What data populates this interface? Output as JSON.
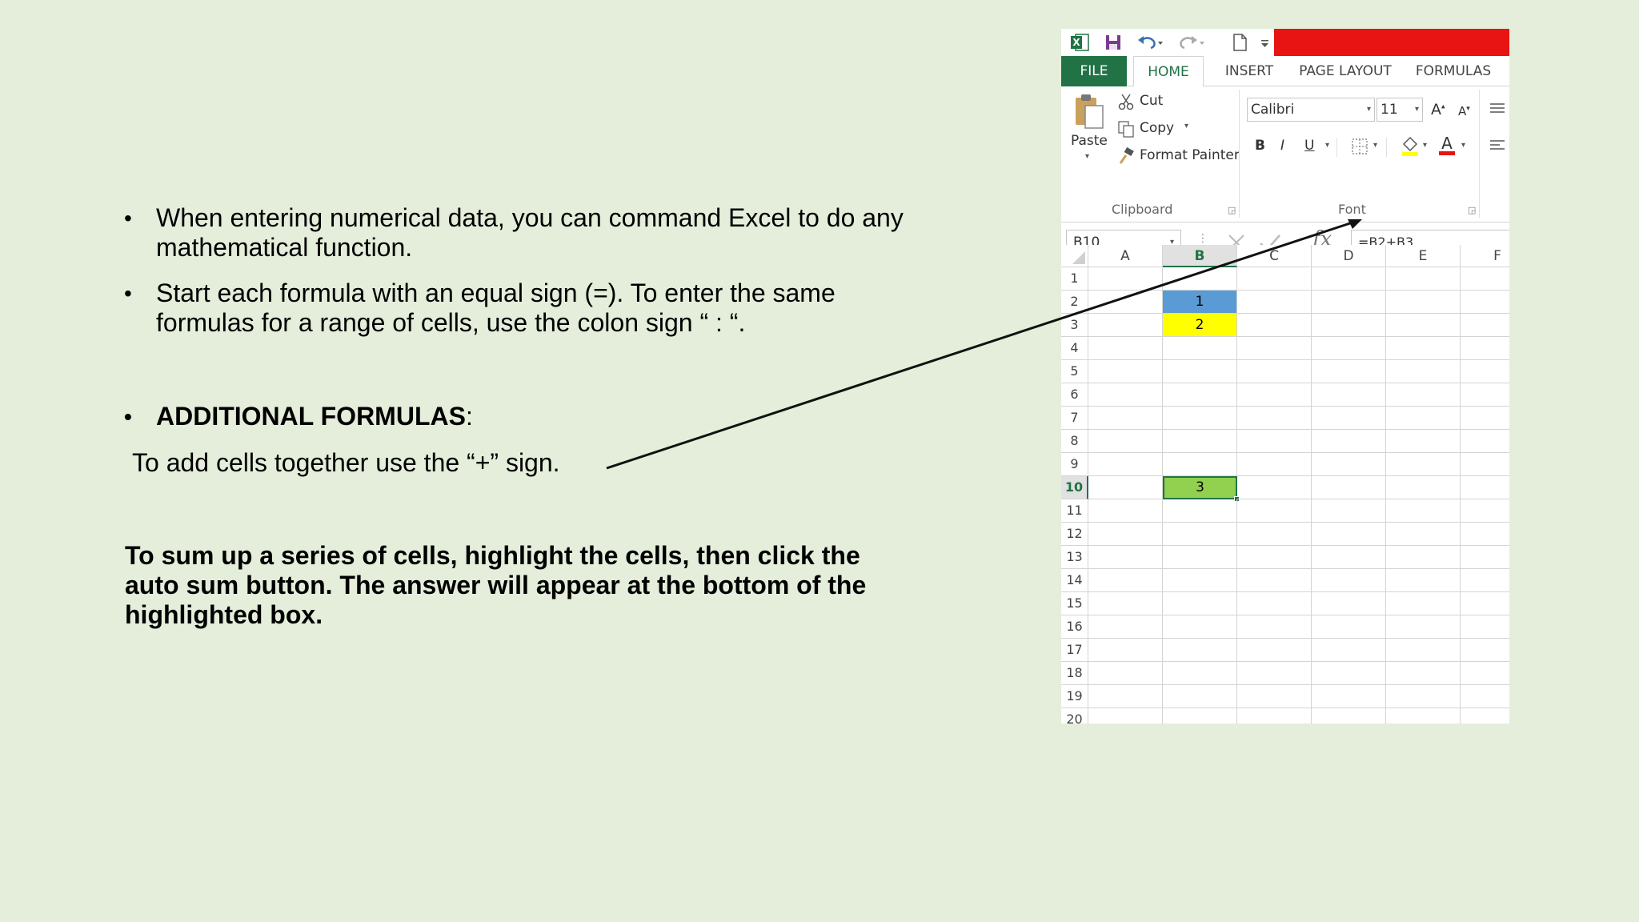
{
  "slide": {
    "bullet_1": "When entering numerical data, you can command Excel to do any mathematical function.",
    "bullet_2": "Start each formula with an equal sign (=). To enter the same formulas for a range of cells, use the colon sign “ : “.",
    "bullet_3_bold": "ADDITIONAL FORMULAS",
    "bullet_3_colon": ":",
    "add_cells_text": "To add cells together use the “+” sign.",
    "sum_paragraph": "To sum up a series of cells, highlight the cells, then click the auto sum button. The answer will appear at the bottom of the highlighted box.",
    "bullet_char": "•"
  },
  "excel": {
    "tabs": {
      "file": "FILE",
      "home": "HOME",
      "insert": "INSERT",
      "page_layout": "PAGE LAYOUT",
      "formulas": "FORMULAS"
    },
    "clipboard": {
      "paste": "Paste",
      "cut": "Cut",
      "copy": "Copy",
      "format_painter": "Format Painter",
      "group_label": "Clipboard"
    },
    "font": {
      "name": "Calibri",
      "size": "11",
      "bold": "B",
      "italic": "I",
      "underline": "U",
      "grow": "A",
      "shrink": "A",
      "font_color": "A",
      "group_label": "Font"
    },
    "name_box": "B10",
    "formula": "=B2+B3",
    "fx": "fx",
    "columns": [
      "A",
      "B",
      "C",
      "D",
      "E",
      "F"
    ],
    "rows": [
      "1",
      "2",
      "3",
      "4",
      "5",
      "6",
      "7",
      "8",
      "9",
      "10",
      "11",
      "12",
      "13",
      "14",
      "15",
      "16",
      "17",
      "18",
      "19",
      "20"
    ],
    "cells": {
      "B2": "1",
      "B3": "2",
      "B10": "3"
    },
    "colors": {
      "excel_green": "#217346",
      "b2_fill": "#5b9bd5",
      "b3_fill": "#ffff00",
      "b10_fill": "#92d050",
      "title_bar_red": "#e81313",
      "slide_background": "#e4eedb"
    }
  }
}
